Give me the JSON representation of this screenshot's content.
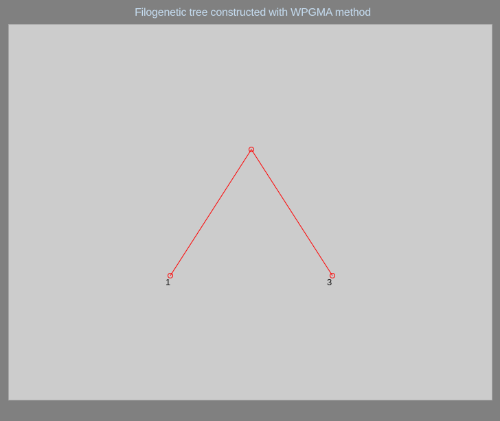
{
  "figure": {
    "title": "Filogenetic tree constructed with WPGMA method"
  },
  "tree": {
    "line_color": "#ff0000",
    "marker_color": "#ff0000",
    "nodes": [
      {
        "id": "root"
      },
      {
        "id": "leaf-1",
        "label": "1"
      },
      {
        "id": "leaf-3",
        "label": "3"
      }
    ],
    "edges": [
      {
        "from": "root",
        "to": "leaf-1"
      },
      {
        "from": "root",
        "to": "leaf-3"
      }
    ]
  }
}
